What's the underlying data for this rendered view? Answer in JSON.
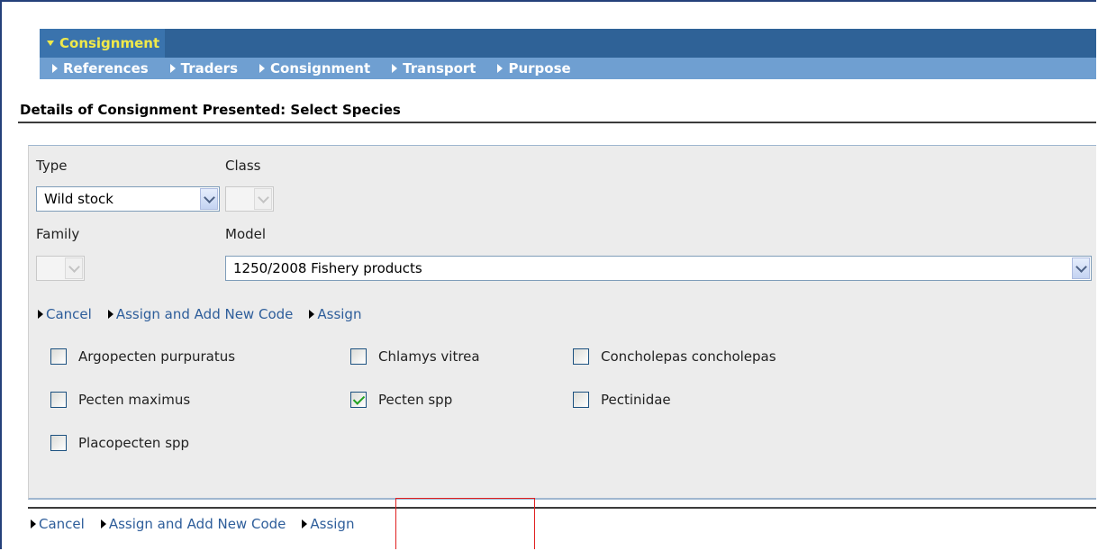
{
  "header": {
    "active_tab": "Consignment",
    "subnav": [
      "References",
      "Traders",
      "Consignment",
      "Transport",
      "Purpose"
    ]
  },
  "page_title": "Details of Consignment Presented: Select Species",
  "form": {
    "type_label": "Type",
    "type_value": "Wild stock",
    "class_label": "Class",
    "class_value": "",
    "family_label": "Family",
    "family_value": "",
    "model_label": "Model",
    "model_value": "1250/2008 Fishery products"
  },
  "top_actions": {
    "cancel": "Cancel",
    "assign_add": "Assign and Add New Code",
    "assign": "Assign"
  },
  "species": [
    {
      "label": "Argopecten purpuratus",
      "checked": false
    },
    {
      "label": "Chlamys vitrea",
      "checked": false
    },
    {
      "label": "Concholepas concholepas",
      "checked": false
    },
    {
      "label": "Pecten maximus",
      "checked": false
    },
    {
      "label": "Pecten spp",
      "checked": true
    },
    {
      "label": "Pectinidae",
      "checked": false
    },
    {
      "label": "Placopecten spp",
      "checked": false
    }
  ],
  "bottom_actions": {
    "cancel": "Cancel",
    "assign_add": "Assign and Add New Code",
    "assign": "Assign"
  },
  "colors": {
    "header_dark": "#2f6297",
    "header_light": "#6f9fd1",
    "active_tab_text": "#f0e94a",
    "link": "#2d5d9a",
    "highlight": "#e02020",
    "check": "#21a121"
  }
}
